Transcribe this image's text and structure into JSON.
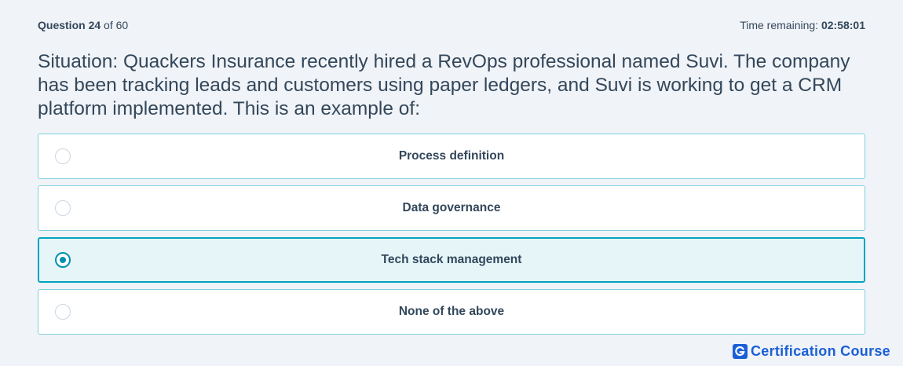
{
  "header": {
    "question_label": "Question",
    "question_number": "24",
    "question_of": "of 60",
    "time_label": "Time remaining:",
    "time_value": "02:58:01"
  },
  "question": {
    "text": "Situation: Quackers Insurance recently hired a RevOps professional named Suvi. The company has been tracking leads and customers using paper ledgers, and Suvi is working to get a CRM platform implemented. This is an example of:"
  },
  "options": [
    {
      "label": "Process definition",
      "selected": false
    },
    {
      "label": "Data governance",
      "selected": false
    },
    {
      "label": "Tech stack management",
      "selected": true
    },
    {
      "label": "None of the above",
      "selected": false
    }
  ],
  "brand": {
    "text": "Certification Course",
    "icon": "g-logo-icon",
    "color": "#1a5fd8"
  },
  "colors": {
    "accent": "#00a4bd",
    "text": "#33475b",
    "background": "#f0f3f7"
  }
}
